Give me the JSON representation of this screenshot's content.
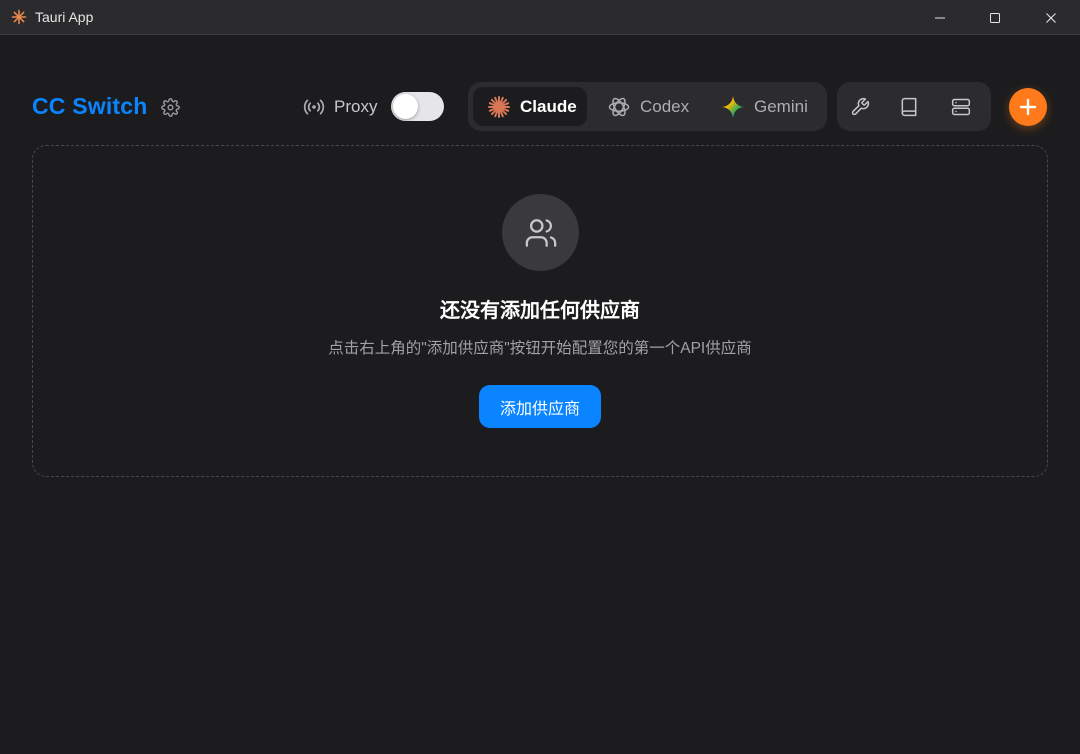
{
  "window": {
    "title": "Tauri App",
    "icons": {
      "app": "tauri-app-icon",
      "minimize": "minimize-icon",
      "maximize": "maximize-icon",
      "close": "close-icon"
    }
  },
  "header": {
    "brand": "CC Switch",
    "settings_icon": "gear-icon",
    "proxy": {
      "label": "Proxy",
      "icon": "broadcast-icon",
      "enabled": false
    },
    "tabs": [
      {
        "label": "Claude",
        "icon": "claude-icon",
        "active": true
      },
      {
        "label": "Codex",
        "icon": "openai-icon",
        "active": false
      },
      {
        "label": "Gemini",
        "icon": "gemini-icon",
        "active": false
      }
    ],
    "tools": [
      "wrench-icon",
      "book-icon",
      "server-icon"
    ],
    "add_icon": "plus-icon"
  },
  "empty_state": {
    "icon": "users-icon",
    "title": "还没有添加任何供应商",
    "description": "点击右上角的\"添加供应商\"按钮开始配置您的第一个API供应商",
    "button_label": "添加供应商"
  },
  "colors": {
    "accent": "#0a84ff",
    "add_button": "#ff7a1a",
    "claude": "#d97757",
    "background": "#1c1c1e"
  }
}
